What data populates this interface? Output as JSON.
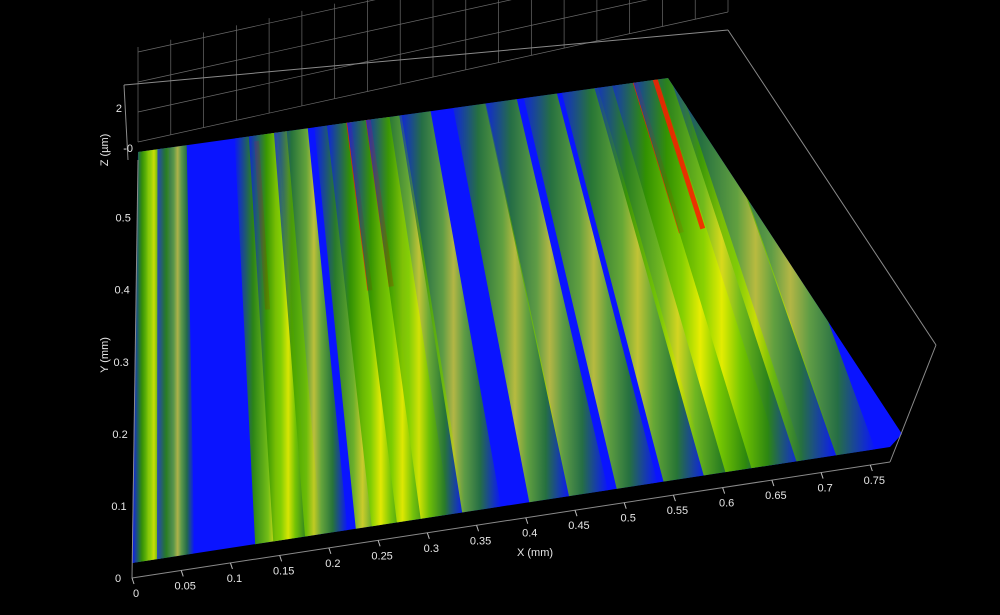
{
  "chart_data": {
    "type": "surface",
    "xlabel": "X (mm)",
    "ylabel": "Y (mm)",
    "zlabel": "Z (µm)",
    "x_ticks": [
      "0",
      "0.05",
      "0.1",
      "0.15",
      "0.2",
      "0.25",
      "0.3",
      "0.35",
      "0.4",
      "0.45",
      "0.5",
      "0.55",
      "0.6",
      "0.65",
      "0.7",
      "0.75"
    ],
    "y_ticks": [
      "0",
      "0.1",
      "0.2",
      "0.3",
      "0.4",
      "0.5"
    ],
    "z_ticks": [
      "-0",
      "2"
    ],
    "xlim": [
      0,
      0.78
    ],
    "ylim": [
      0,
      0.6
    ],
    "grid": true,
    "colormap": [
      "#0a14ff",
      "#2f8f00",
      "#7fcf00",
      "#f2f200",
      "#ff1a00"
    ],
    "ridges": [
      {
        "x": 0.005,
        "z": 0.8
      },
      {
        "x": 0.02,
        "z": 0.5
      },
      {
        "x": 0.045,
        "z": 0.4
      },
      {
        "x": 0.155,
        "z": 0.9
      },
      {
        "x": 0.17,
        "z": 0.7
      },
      {
        "x": 0.2,
        "z": 0.55
      },
      {
        "x": 0.255,
        "z": 0.7
      },
      {
        "x": 0.275,
        "z": 0.9
      },
      {
        "x": 0.3,
        "z": 0.85
      },
      {
        "x": 0.32,
        "z": 0.6
      },
      {
        "x": 0.36,
        "z": 0.45
      },
      {
        "x": 0.43,
        "z": 0.5
      },
      {
        "x": 0.47,
        "z": 0.45
      },
      {
        "x": 0.52,
        "z": 0.5
      },
      {
        "x": 0.57,
        "z": 0.6
      },
      {
        "x": 0.615,
        "z": 0.8
      },
      {
        "x": 0.64,
        "z": 0.95
      },
      {
        "x": 0.665,
        "z": 0.85
      },
      {
        "x": 0.705,
        "z": 0.5
      },
      {
        "x": 0.745,
        "z": 0.45
      }
    ]
  }
}
